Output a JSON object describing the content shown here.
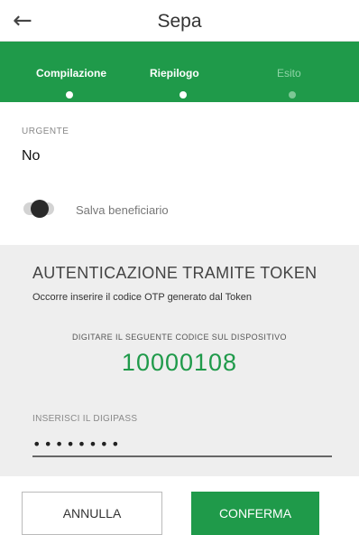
{
  "header": {
    "back_icon": "arrow-left-icon",
    "title": "Sepa"
  },
  "steps": [
    {
      "label": "Compilazione",
      "state": "active"
    },
    {
      "label": "Riepilogo",
      "state": "active"
    },
    {
      "label": "Esito",
      "state": "inactive"
    }
  ],
  "colors": {
    "accent": "#1f9a4a",
    "panel": "#eeeeee"
  },
  "urgente": {
    "label": "URGENTE",
    "value": "No"
  },
  "salva": {
    "label": "Salva beneficiario",
    "checked": false
  },
  "token": {
    "title": "AUTENTICAZIONE TRAMITE TOKEN",
    "subtitle": "Occorre inserire il codice OTP generato dal Token",
    "instruction": "DIGITARE IL SEGUENTE CODICE SUL DISPOSITIVO",
    "code": "10000108",
    "input_label": "INSERISCI IL DIGIPASS",
    "input_value": "••••••••"
  },
  "actions": {
    "cancel": "ANNULLA",
    "confirm": "CONFERMA"
  }
}
